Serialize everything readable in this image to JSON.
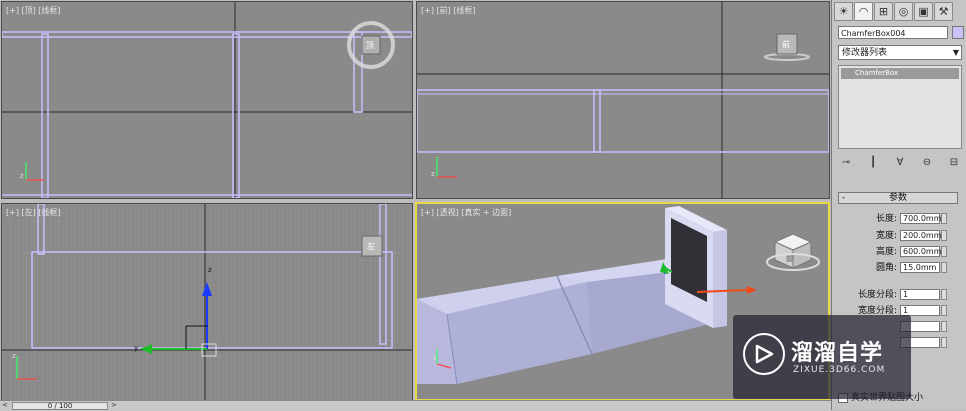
{
  "viewports": {
    "top_left": {
      "label": "[+] [顶] [线框]"
    },
    "top_right": {
      "label": "[+] [前] [线框]"
    },
    "bottom_left": {
      "label": "[+] [左] [线框]"
    },
    "perspective": {
      "label": "[+] [透视] [真实 + 边面]"
    }
  },
  "axis_labels": {
    "x": "x",
    "y": "y",
    "z": "z"
  },
  "viewcube_faces": {
    "top": "顶",
    "front": "前",
    "left": "左",
    "perspective": "前"
  },
  "command_panel": {
    "tabs": [
      "sun-icon",
      "arc-icon",
      "hierarchy-icon",
      "motion-icon",
      "display-icon",
      "hammer-icon"
    ],
    "object_name": "ChamferBox004",
    "object_color": "#c9c2f4",
    "modifier_list": "修改器列表",
    "stack_item": "ChamferBox",
    "rollout_title": "参数",
    "params": [
      {
        "label": "长度:",
        "value": "700.0mm"
      },
      {
        "label": "宽度:",
        "value": "200.0mm"
      },
      {
        "label": "高度:",
        "value": "600.0mm"
      },
      {
        "label": "圆角:",
        "value": "15.0mm"
      },
      {
        "label": "长度分段:",
        "value": "1"
      },
      {
        "label": "宽度分段:",
        "value": "1"
      },
      {
        "label": "",
        "value": ""
      },
      {
        "label": "",
        "value": ""
      }
    ],
    "checkbox_label": "真实世界贴图大小"
  },
  "status": {
    "time_slider": "0 / 100",
    "prev": "<",
    "next": ">"
  },
  "watermark": {
    "title": "溜溜自学",
    "url": "ZIXUE.3D66.COM"
  },
  "colors": {
    "active_viewport": "#e8d84a",
    "wire": "#c8c0ff",
    "viewport_bg": "#8a8a8a"
  }
}
